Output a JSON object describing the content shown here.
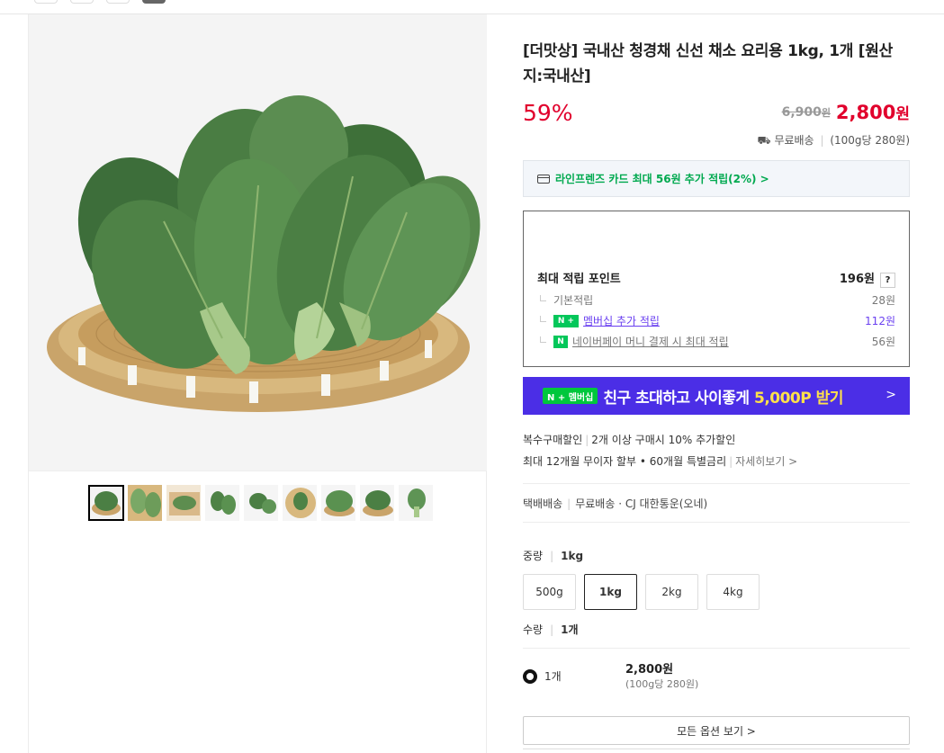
{
  "product": {
    "title": "[더맛상] 국내산 청경채 신선 채소 요리용 1kg, 1개 [원산지:국내산]",
    "discount": "59%",
    "original_price": "6,900",
    "original_unit": "원",
    "price": "2,800",
    "price_unit": "원",
    "shipping_label": "무료배송",
    "unit_price": "(100g당 280원)"
  },
  "card_offer": "라인프렌즈 카드 최대 56원 추가 적립(2%) >",
  "points": {
    "title": "최대 적립 포인트",
    "total": "196원",
    "help": "?",
    "basic_label": "기본적립",
    "basic_value": "28원",
    "membership_badge": "N +",
    "membership_label": "멤버십 추가 적립",
    "membership_value": "112원",
    "npay_badge": "N",
    "npay_label": "네이버페이 머니 결제 시 최대 적립",
    "npay_value": "56원"
  },
  "banner": {
    "badge": "N + 멤버십",
    "text": "친구 초대하고 사이좋게",
    "highlight": "5,000P 받기",
    "arrow": ">"
  },
  "promo": {
    "label1": "복수구매할인",
    "text1": "2개 이상 구매시 10% 추가할인",
    "text2": "최대 12개월 무이자 할부 • 60개월 특별금리",
    "detail_link": "자세히보기 >"
  },
  "delivery": {
    "type": "택배배송",
    "fee": "무료배송",
    "carrier": "CJ 대한통운(오네)"
  },
  "weight_option": {
    "label": "중량",
    "selected": "1kg",
    "choices": [
      "500g",
      "1kg",
      "2kg",
      "4kg"
    ]
  },
  "quantity_option": {
    "label": "수량",
    "selected": "1개"
  },
  "option_row": {
    "name": "1개",
    "price": "2,800원",
    "unit": "(100g당 280원)"
  },
  "all_options_label": "모든 옵션 보기 >",
  "colors": {
    "accent_red": "#e1002c",
    "naver_green": "#03c75a",
    "banner_purple": "#4b2ee6"
  }
}
